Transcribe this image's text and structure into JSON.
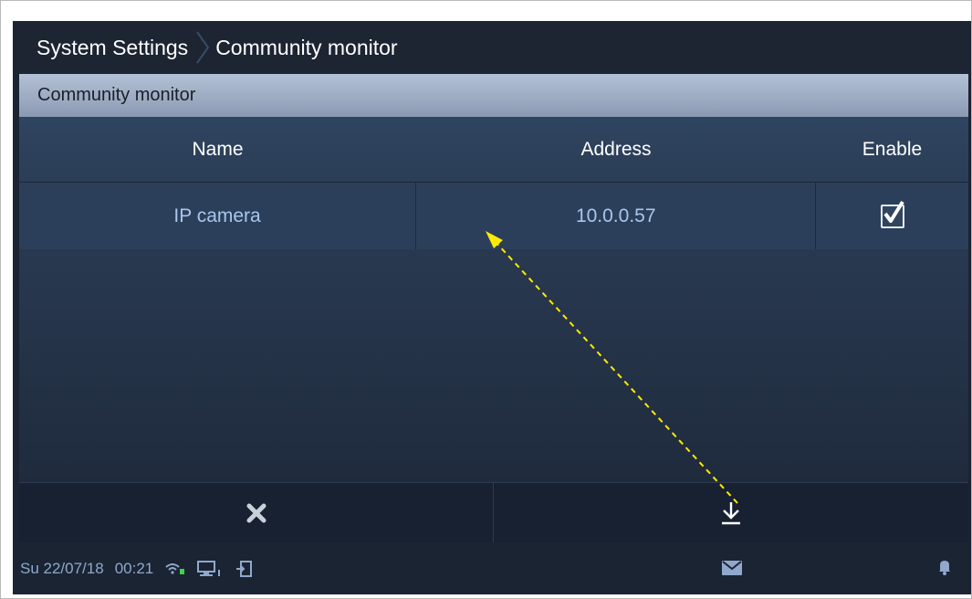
{
  "header": {
    "title_parent": "System Settings",
    "title_current": "Community monitor"
  },
  "section": {
    "title": "Community monitor"
  },
  "table": {
    "columns": [
      "Name",
      "Address",
      "Enable"
    ],
    "rows": [
      {
        "name": "IP camera",
        "address": "10.0.0.57",
        "enabled": true
      }
    ]
  },
  "actions": {
    "cancel_icon": "close-icon",
    "save_icon": "download-icon"
  },
  "statusbar": {
    "date": "Su 22/07/18",
    "time": "00:21",
    "icons": [
      "wifi-icon",
      "monitor-icon",
      "door-icon",
      "mail-icon",
      "bell-icon"
    ]
  },
  "colors": {
    "background": "#1b2433",
    "section_bar": "#9aa9c0",
    "row_text": "#a9c6ec",
    "annotation_arrow": "#ffeb00"
  }
}
